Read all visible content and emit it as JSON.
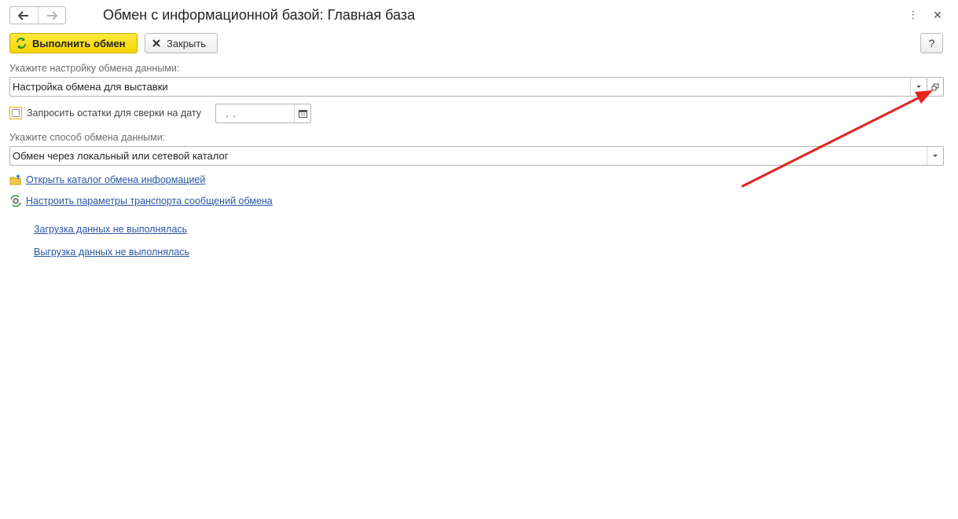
{
  "window": {
    "title": "Обмен с информационной базой: Главная база",
    "more_icon": "⋮",
    "close_icon": "✕"
  },
  "toolbar": {
    "execute_label": "Выполнить обмен",
    "close_label": "Закрыть",
    "help_label": "?"
  },
  "form": {
    "setting_label": "Укажите настройку обмена данными:",
    "setting_value": "Настройка обмена для выставки",
    "request_balance_label": "Запросить остатки для сверки на дату",
    "request_balance_checked": false,
    "date_value": ".  .",
    "method_label": "Укажите способ обмена данными:",
    "method_value": "Обмен через локальный или сетевой каталог"
  },
  "links": {
    "open_catalog": "Открыть каталог обмена информацией",
    "configure_transport": "Настроить параметры транспорта сообщений обмена",
    "import_status": "Загрузка данных не выполнялась",
    "export_status": "Выгрузка данных не выполнялась"
  },
  "colors": {
    "accent_yellow": "#f5d300",
    "link_blue": "#2b55a3",
    "annotation_red": "#e8231b"
  }
}
